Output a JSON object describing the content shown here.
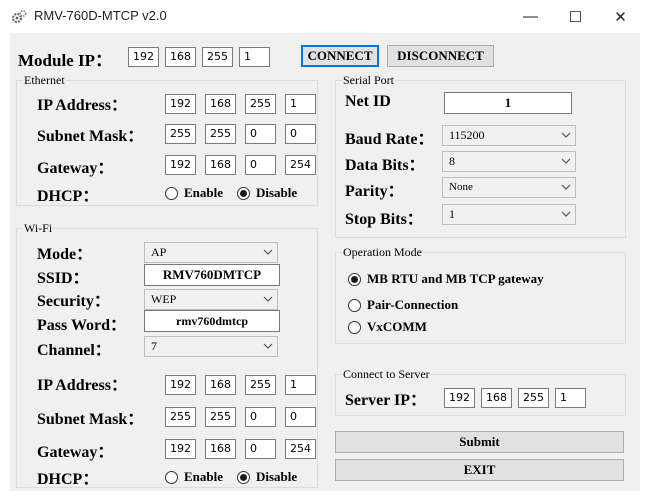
{
  "window": {
    "title": "RMV-760D-MTCP  v2.0",
    "minimize": "—",
    "maximize": "☐",
    "close": "✕"
  },
  "module_ip": {
    "label": "Module IP：",
    "octets": [
      "192",
      "168",
      "255",
      "1"
    ]
  },
  "buttons": {
    "connect": "CONNECT",
    "disconnect": "DISCONNECT",
    "submit": "Submit",
    "exit": "EXIT"
  },
  "ethernet": {
    "title": "Ethernet",
    "ip_label": "IP Address：",
    "ip": [
      "192",
      "168",
      "255",
      "1"
    ],
    "mask_label": "Subnet Mask：",
    "mask": [
      "255",
      "255",
      "0",
      "0"
    ],
    "gateway_label": "Gateway：",
    "gateway": [
      "192",
      "168",
      "0",
      "254"
    ],
    "dhcp_label": "DHCP：",
    "enable": "Enable",
    "disable": "Disable",
    "dhcp_selected": "Disable"
  },
  "wifi": {
    "title": "Wi-Fi",
    "mode_label": "Mode：",
    "mode": "AP",
    "ssid_label": "SSID：",
    "ssid": "RMV760DMTCP",
    "security_label": "Security：",
    "security": "WEP",
    "password_label": "Pass Word：",
    "password": "rmv760dmtcp",
    "channel_label": "Channel：",
    "channel": "7",
    "ip_label": "IP Address：",
    "ip": [
      "192",
      "168",
      "255",
      "1"
    ],
    "mask_label": "Subnet Mask：",
    "mask": [
      "255",
      "255",
      "0",
      "0"
    ],
    "gateway_label": "Gateway：",
    "gateway": [
      "192",
      "168",
      "0",
      "254"
    ],
    "dhcp_label": "DHCP：",
    "enable": "Enable",
    "disable": "Disable",
    "dhcp_selected": "Disable"
  },
  "serial": {
    "title": "Serial Port",
    "netid_label": "Net ID",
    "netid": "1",
    "baud_label": "Baud Rate：",
    "baud": "115200",
    "databits_label": "Data Bits：",
    "databits": "8",
    "parity_label": "Parity：",
    "parity": "None",
    "stopbits_label": "Stop Bits：",
    "stopbits": "1"
  },
  "operation": {
    "title": "Operation Mode",
    "options": [
      "MB RTU and MB TCP gateway",
      "Pair-Connection",
      "VxCOMM"
    ],
    "selected": "MB RTU and MB TCP gateway"
  },
  "server": {
    "title": "Connect to Server",
    "label": "Server IP：",
    "octets": [
      "192",
      "168",
      "255",
      "1"
    ]
  },
  "colors": {
    "focus_border": "#0078d7",
    "client_bg": "#f0f0f0"
  },
  "icons": {
    "app": "gears-icon",
    "combo": "chevron-down-icon"
  }
}
